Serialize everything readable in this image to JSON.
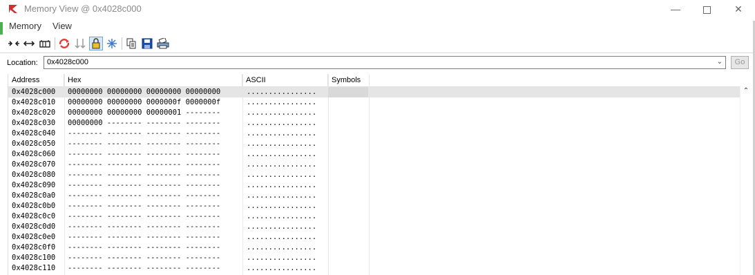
{
  "window": {
    "title": "Memory View @ 0x4028c000"
  },
  "menu": {
    "items": [
      {
        "label": "Memory"
      },
      {
        "label": "View"
      }
    ]
  },
  "toolbar": {
    "buttons": [
      {
        "icon": "collapse-arrows-icon"
      },
      {
        "icon": "expand-arrows-icon"
      },
      {
        "icon": "format-columns-icon"
      },
      {
        "icon": "refresh-icon"
      },
      {
        "icon": "sort-icon"
      },
      {
        "icon": "lock-icon"
      },
      {
        "icon": "freeze-icon"
      },
      {
        "icon": "copy-icon"
      },
      {
        "icon": "save-icon"
      },
      {
        "icon": "print-icon"
      }
    ]
  },
  "location": {
    "label": "Location:",
    "value": "0x4028c000",
    "go_label": "Go"
  },
  "table": {
    "columns": [
      "Address",
      "Hex",
      "ASCII",
      "Symbols"
    ],
    "rows": [
      {
        "address": "0x4028c000",
        "hex": "00000000 00000000 00000000 00000000",
        "ascii": "................"
      },
      {
        "address": "0x4028c010",
        "hex": "00000000 00000000 0000000f 0000000f",
        "ascii": "................"
      },
      {
        "address": "0x4028c020",
        "hex": "00000000 00000000 00000001 --------",
        "ascii": "................"
      },
      {
        "address": "0x4028c030",
        "hex": "00000000 -------- -------- --------",
        "ascii": "................"
      },
      {
        "address": "0x4028c040",
        "hex": "-------- -------- -------- --------",
        "ascii": "................"
      },
      {
        "address": "0x4028c050",
        "hex": "-------- -------- -------- --------",
        "ascii": "................"
      },
      {
        "address": "0x4028c060",
        "hex": "-------- -------- -------- --------",
        "ascii": "................"
      },
      {
        "address": "0x4028c070",
        "hex": "-------- -------- -------- --------",
        "ascii": "................"
      },
      {
        "address": "0x4028c080",
        "hex": "-------- -------- -------- --------",
        "ascii": "................"
      },
      {
        "address": "0x4028c090",
        "hex": "-------- -------- -------- --------",
        "ascii": "................"
      },
      {
        "address": "0x4028c0a0",
        "hex": "-------- -------- -------- --------",
        "ascii": "................"
      },
      {
        "address": "0x4028c0b0",
        "hex": "-------- -------- -------- --------",
        "ascii": "................"
      },
      {
        "address": "0x4028c0c0",
        "hex": "-------- -------- -------- --------",
        "ascii": "................"
      },
      {
        "address": "0x4028c0d0",
        "hex": "-------- -------- -------- --------",
        "ascii": "................"
      },
      {
        "address": "0x4028c0e0",
        "hex": "-------- -------- -------- --------",
        "ascii": "................"
      },
      {
        "address": "0x4028c0f0",
        "hex": "-------- -------- -------- --------",
        "ascii": "................"
      },
      {
        "address": "0x4028c100",
        "hex": "-------- -------- -------- --------",
        "ascii": "................"
      },
      {
        "address": "0x4028c110",
        "hex": "-------- -------- -------- --------",
        "ascii": "................"
      }
    ],
    "selected_row": 0
  }
}
